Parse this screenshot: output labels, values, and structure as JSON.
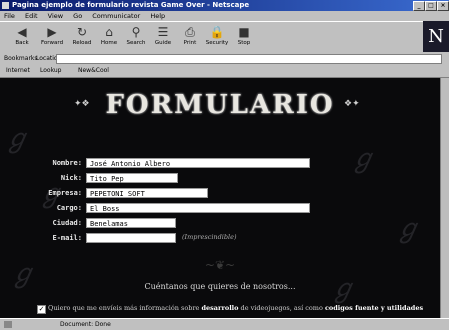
{
  "window": {
    "title": "Pagina ejemplo de formulario revista Game Over - Netscape",
    "controls": [
      "_",
      "□",
      "×"
    ]
  },
  "menu": [
    "File",
    "Edit",
    "View",
    "Go",
    "Communicator",
    "Help"
  ],
  "toolbar": {
    "buttons": [
      {
        "label": "Back",
        "icon": "back-arrow-icon"
      },
      {
        "label": "Forward",
        "icon": "forward-arrow-icon"
      },
      {
        "label": "Reload",
        "icon": "reload-icon"
      },
      {
        "label": "Home",
        "icon": "home-icon"
      },
      {
        "label": "Search",
        "icon": "search-icon"
      },
      {
        "label": "Guide",
        "icon": "guide-icon"
      },
      {
        "label": "Print",
        "icon": "print-icon"
      },
      {
        "label": "Security",
        "icon": "security-icon"
      },
      {
        "label": "Stop",
        "icon": "stop-icon"
      }
    ],
    "logo": "N"
  },
  "location": {
    "bookmarks": "Bookmarks",
    "label": "Location:"
  },
  "links": [
    "Internet",
    "Lookup",
    "New&Cool"
  ],
  "page": {
    "title": "FORMULARIO",
    "form": [
      {
        "label": "Nombre:",
        "value": "José Antonio Albero"
      },
      {
        "label": "Nick:",
        "value": "Tito Pep"
      },
      {
        "label": "Empresa:",
        "value": "PEPETONI SOFT"
      },
      {
        "label": "Cargo:",
        "value": "El Boss"
      },
      {
        "label": "Ciudad:",
        "value": "Benelamas"
      },
      {
        "label": "E-mail:",
        "value": ""
      }
    ],
    "email_note": "(Imprescindible)",
    "subtitle": "Cuéntanos que quieres de nosotros...",
    "checkbox": {
      "checked": true,
      "text_a": "Quiero que me envíeis más información sobre ",
      "bold_a": "desarrollo",
      "text_b": " de videojuegos, así como ",
      "bold_b": "codigos fuente y utilidades"
    }
  },
  "status": {
    "text": "Document: Done"
  }
}
